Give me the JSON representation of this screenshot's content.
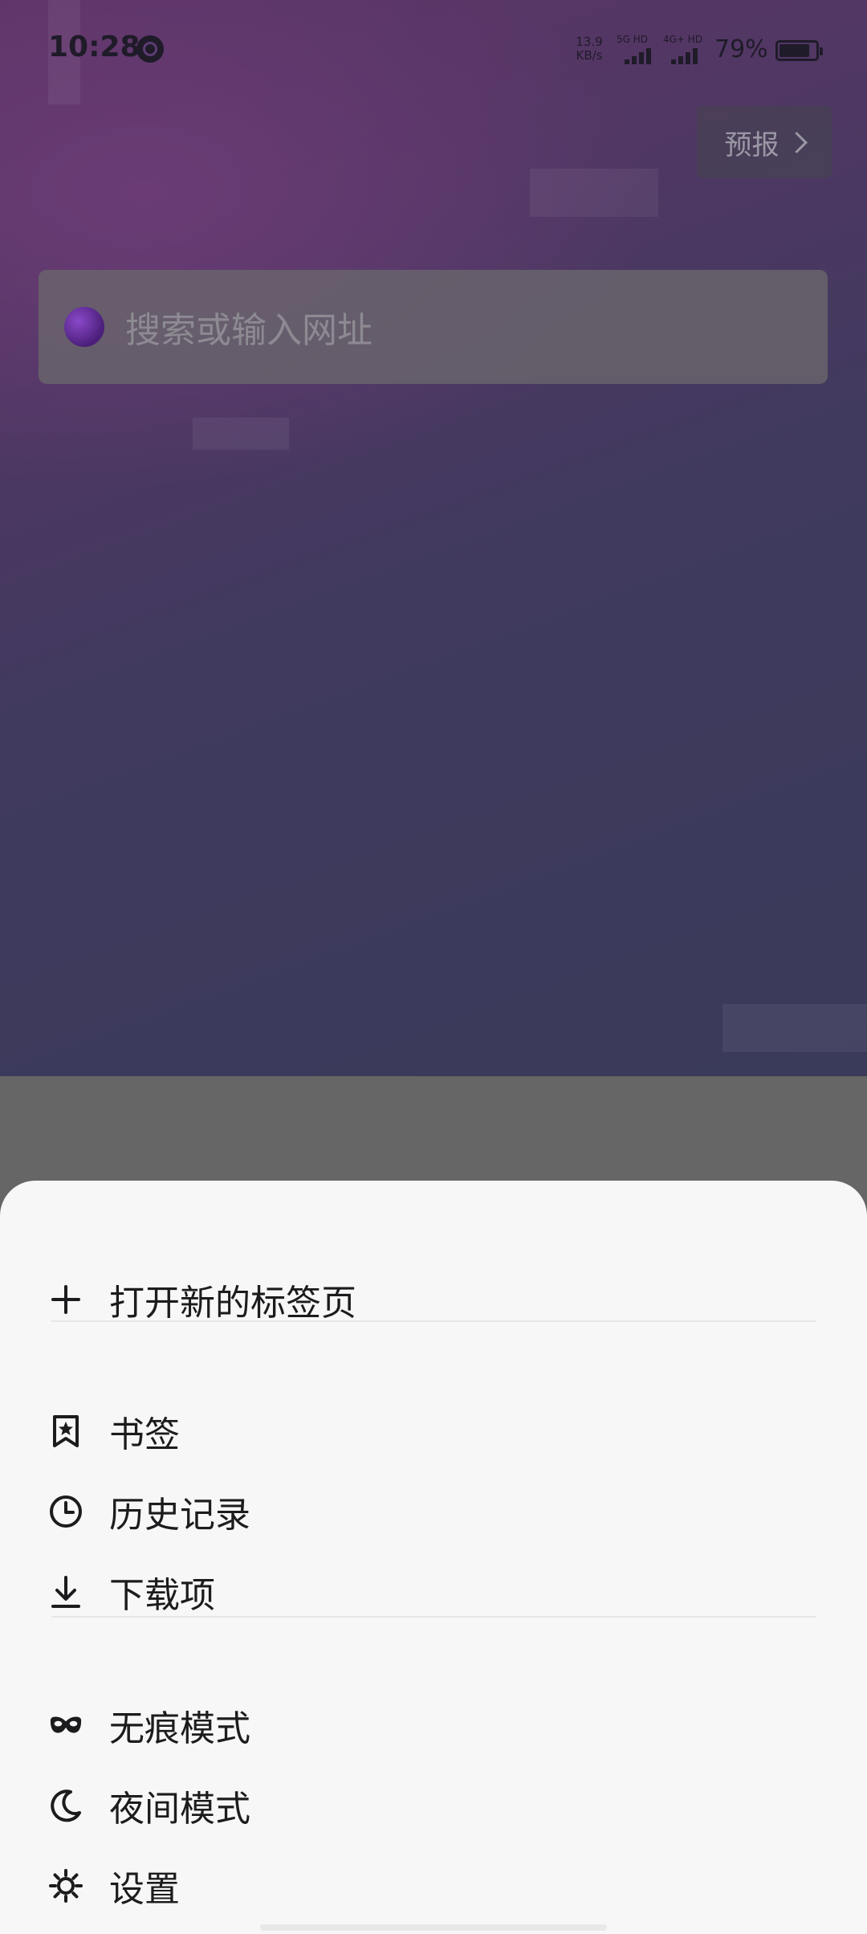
{
  "status_bar": {
    "time": "10:28",
    "net_speed_value": "13.9",
    "net_speed_unit": "KB/s",
    "sim1_label": "5G HD",
    "sim2_label": "4G+ HD",
    "battery_percent": "79%"
  },
  "header": {
    "forecast_label": "预报"
  },
  "search": {
    "placeholder": "搜索或输入网址"
  },
  "menu": {
    "new_tab": "打开新的标签页",
    "bookmarks": "书签",
    "history": "历史记录",
    "downloads": "下载项",
    "incognito": "无痕模式",
    "night_mode": "夜间模式",
    "settings": "设置"
  },
  "icons": {
    "new_tab": "plus-icon",
    "bookmarks": "bookmark-star-icon",
    "history": "clock-icon",
    "downloads": "download-icon",
    "incognito": "mask-icon",
    "night_mode": "moon-icon",
    "settings": "gear-icon"
  },
  "colors": {
    "sheet_background": "#f7f7f7",
    "text_primary": "#1c1c1e",
    "search_logo": "#6a2fa8"
  }
}
